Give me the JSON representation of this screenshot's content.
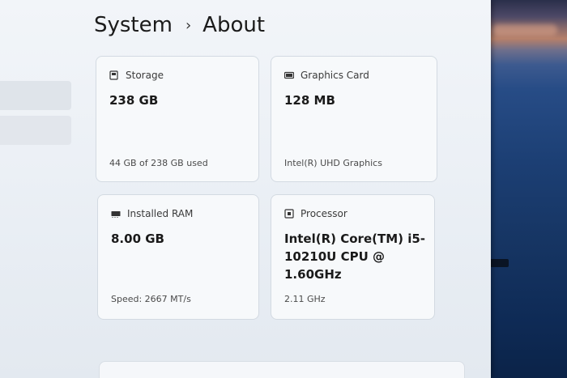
{
  "breadcrumb": {
    "parent": "System",
    "separator": "›",
    "current": "About"
  },
  "cards": {
    "storage": {
      "icon": "storage-drive-icon",
      "label": "Storage",
      "value": "238 GB",
      "detail": "44 GB of 238 GB used"
    },
    "graphics": {
      "icon": "graphics-card-icon",
      "label": "Graphics Card",
      "value": "128 MB",
      "detail": "Intel(R) UHD Graphics"
    },
    "ram": {
      "icon": "memory-icon",
      "label": "Installed RAM",
      "value": "8.00 GB",
      "detail": "Speed: 2667 MT/s"
    },
    "processor": {
      "icon": "processor-chip-icon",
      "label": "Processor",
      "value": "Intel(R) Core(TM) i5-10210U CPU @ 1.60GHz",
      "detail": "2.11 GHz"
    }
  }
}
